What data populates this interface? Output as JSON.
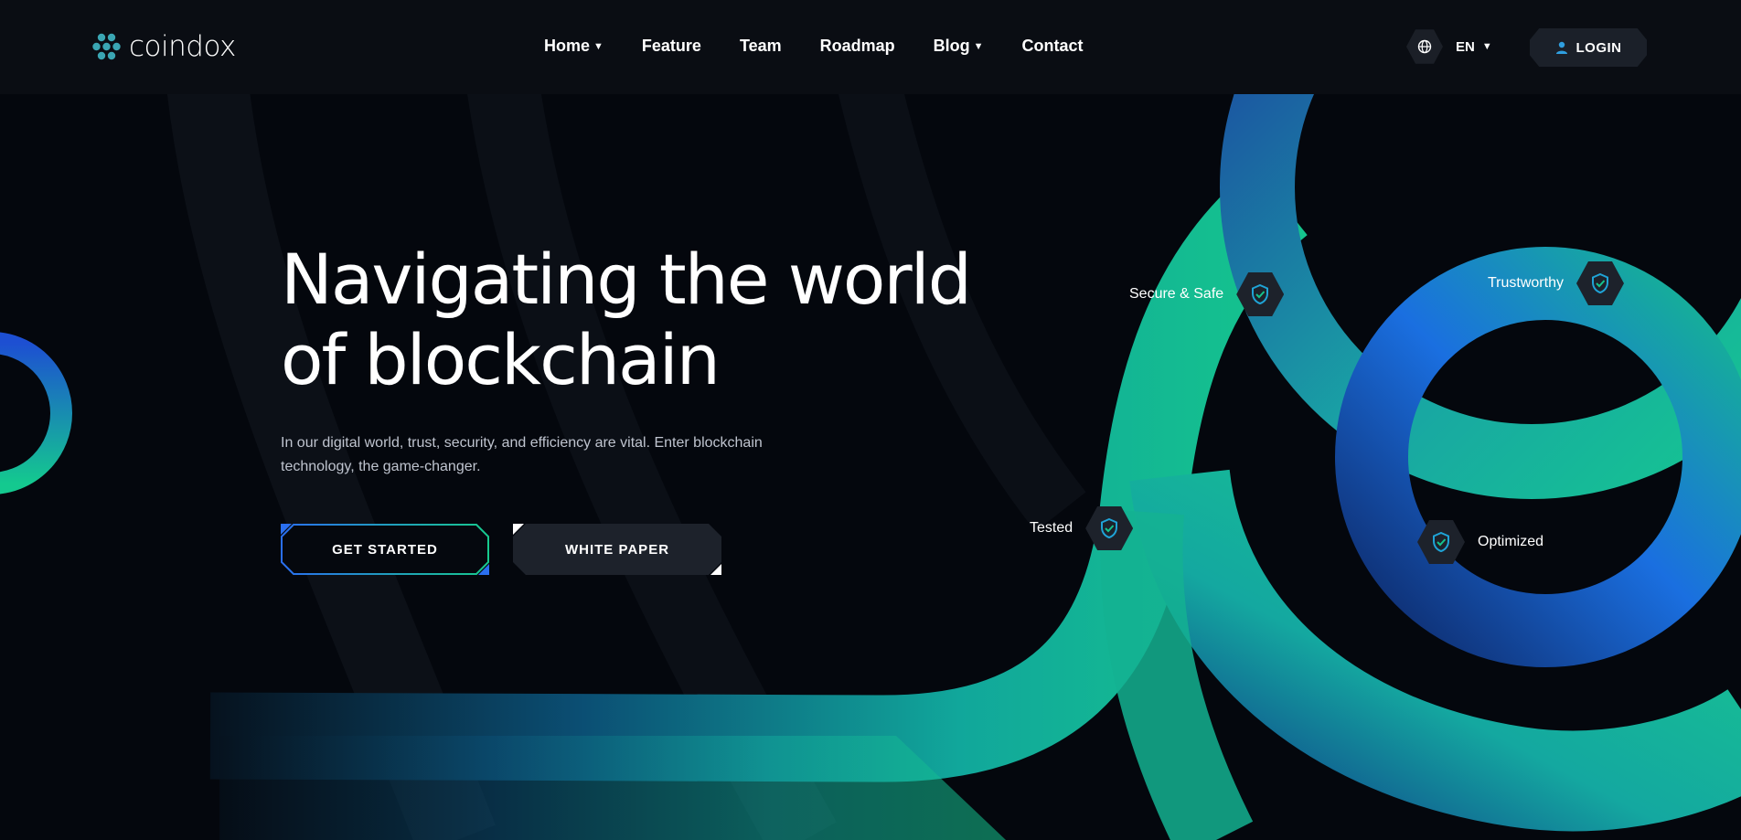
{
  "brand": {
    "name": "coindox"
  },
  "nav": [
    {
      "label": "Home",
      "dropdown": true
    },
    {
      "label": "Feature",
      "dropdown": false
    },
    {
      "label": "Team",
      "dropdown": false
    },
    {
      "label": "Roadmap",
      "dropdown": false
    },
    {
      "label": "Blog",
      "dropdown": true
    },
    {
      "label": "Contact",
      "dropdown": false
    }
  ],
  "language": {
    "selected": "EN",
    "icon": "globe-icon"
  },
  "login": {
    "label": "LOGIN",
    "icon": "user-icon"
  },
  "hero": {
    "title_line1": "Navigating the world",
    "title_line2": "of blockchain",
    "description": "In our digital world, trust, security, and efficiency are vital. Enter blockchain technology, the game-changer.",
    "primary_button": "GET STARTED",
    "secondary_button": "WHITE PAPER"
  },
  "badges": [
    {
      "label": "Secure & Safe",
      "icon": "shield-check-icon"
    },
    {
      "label": "Trustworthy",
      "icon": "shield-check-icon"
    },
    {
      "label": "Tested",
      "icon": "shield-check-icon"
    },
    {
      "label": "Optimized",
      "icon": "shield-check-icon"
    }
  ],
  "colors": {
    "background": "#04070d",
    "header": "#0a0d13",
    "accent_green": "#14c98f",
    "accent_blue": "#1f63e6"
  }
}
